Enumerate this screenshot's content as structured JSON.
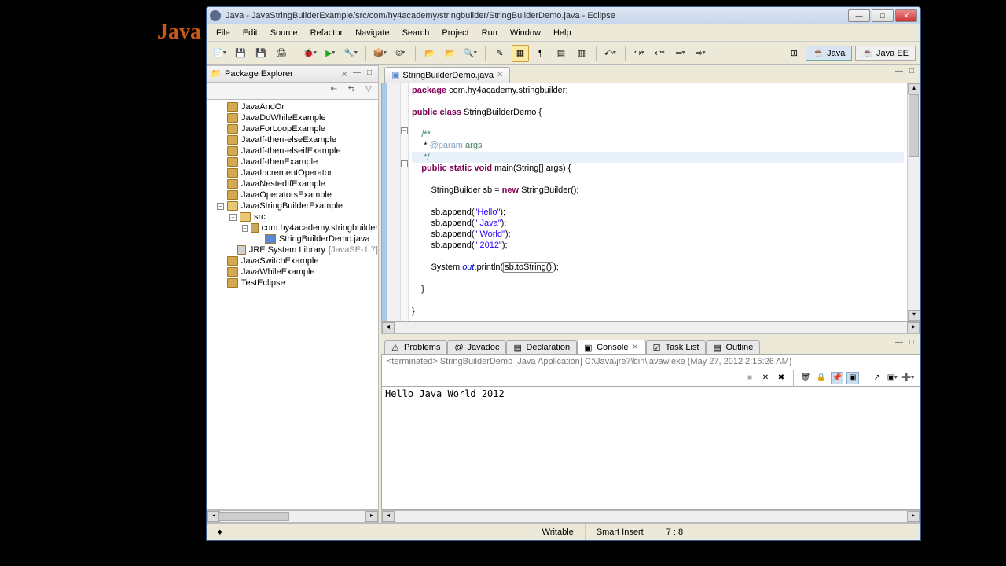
{
  "bg_text": "Java",
  "window": {
    "title": "Java - JavaStringBuilderExample/src/com/hy4academy/stringbuilder/StringBuilderDemo.java - Eclipse"
  },
  "menu": [
    "File",
    "Edit",
    "Source",
    "Refactor",
    "Navigate",
    "Search",
    "Project",
    "Run",
    "Window",
    "Help"
  ],
  "perspectives": {
    "java": "Java",
    "javaee": "Java EE"
  },
  "package_explorer": {
    "title": "Package Explorer",
    "items": [
      {
        "label": "JavaAndOr",
        "type": "project"
      },
      {
        "label": "JavaDoWhileExample",
        "type": "project"
      },
      {
        "label": "JavaForLoopExample",
        "type": "project"
      },
      {
        "label": "JavaIf-then-elseExample",
        "type": "project"
      },
      {
        "label": "JavaIf-then-elseifExample",
        "type": "project"
      },
      {
        "label": "JavaIf-thenExample",
        "type": "project"
      },
      {
        "label": "JavaIncrementOperator",
        "type": "project"
      },
      {
        "label": "JavaNestedIfExample",
        "type": "project"
      },
      {
        "label": "JavaOperatorsExample",
        "type": "project"
      },
      {
        "label": "JavaStringBuilderExample",
        "type": "project",
        "expanded": true,
        "children": [
          {
            "label": "src",
            "type": "src",
            "expanded": true,
            "children": [
              {
                "label": "com.hy4academy.stringbuilder",
                "type": "pkg",
                "expanded": true,
                "children": [
                  {
                    "label": "StringBuilderDemo.java",
                    "type": "java"
                  }
                ]
              }
            ]
          },
          {
            "label": "JRE System Library",
            "type": "lib",
            "version": "[JavaSE-1.7]"
          }
        ]
      },
      {
        "label": "JavaSwitchExample",
        "type": "project"
      },
      {
        "label": "JavaWhileExample",
        "type": "project"
      },
      {
        "label": "TestEclipse",
        "type": "project"
      }
    ]
  },
  "editor": {
    "tab_label": "StringBuilderDemo.java",
    "code_lines": [
      {
        "t": "package ",
        "cls": "kw",
        "rest": "com.hy4academy.stringbuilder;"
      },
      {
        "blank": true
      },
      {
        "parts": [
          {
            "t": "public ",
            "c": "kw"
          },
          {
            "t": "class ",
            "c": "kw"
          },
          {
            "t": "StringBuilderDemo {"
          }
        ]
      },
      {
        "blank": true
      },
      {
        "parts": [
          {
            "t": "    "
          },
          {
            "t": "/**",
            "c": "cm"
          }
        ]
      },
      {
        "parts": [
          {
            "t": "     * "
          },
          {
            "t": "@param",
            "c": "tag"
          },
          {
            "t": " args",
            "c": "cm"
          }
        ]
      },
      {
        "parts": [
          {
            "t": "     */",
            "c": "cm"
          }
        ],
        "hl": true
      },
      {
        "parts": [
          {
            "t": "    "
          },
          {
            "t": "public ",
            "c": "kw"
          },
          {
            "t": "static ",
            "c": "kw"
          },
          {
            "t": "void ",
            "c": "kw"
          },
          {
            "t": "main(String[] args) {"
          }
        ]
      },
      {
        "blank": true
      },
      {
        "parts": [
          {
            "t": "        StringBuilder sb = "
          },
          {
            "t": "new ",
            "c": "kw"
          },
          {
            "t": "StringBuilder();"
          }
        ]
      },
      {
        "blank": true
      },
      {
        "parts": [
          {
            "t": "        sb.append("
          },
          {
            "t": "\"Hello\"",
            "c": "str"
          },
          {
            "t": ");"
          }
        ]
      },
      {
        "parts": [
          {
            "t": "        sb.append("
          },
          {
            "t": "\" Java\"",
            "c": "str"
          },
          {
            "t": ");"
          }
        ]
      },
      {
        "parts": [
          {
            "t": "        sb.append("
          },
          {
            "t": "\" World\"",
            "c": "str"
          },
          {
            "t": ");"
          }
        ]
      },
      {
        "parts": [
          {
            "t": "        sb.append("
          },
          {
            "t": "\" 2012\"",
            "c": "str"
          },
          {
            "t": ");"
          }
        ]
      },
      {
        "blank": true
      },
      {
        "parts": [
          {
            "t": "        System."
          },
          {
            "t": "out",
            "c": "fld"
          },
          {
            "t": ".println("
          },
          {
            "t": "sb.toString()",
            "box": true
          },
          {
            "t": ");"
          }
        ]
      },
      {
        "blank": true
      },
      {
        "parts": [
          {
            "t": "    }"
          }
        ]
      },
      {
        "blank": true
      },
      {
        "parts": [
          {
            "t": "}"
          }
        ]
      }
    ]
  },
  "bottom_tabs": {
    "problems": "Problems",
    "javadoc": "Javadoc",
    "declaration": "Declaration",
    "console": "Console",
    "tasklist": "Task List",
    "outline": "Outline"
  },
  "console": {
    "info": "<terminated> StringBuilderDemo [Java Application] C:\\Java\\jre7\\bin\\javaw.exe (May 27, 2012 2:15:26 AM)",
    "output": "Hello Java World 2012"
  },
  "status": {
    "writable": "Writable",
    "insert": "Smart Insert",
    "pos": "7 : 8"
  }
}
